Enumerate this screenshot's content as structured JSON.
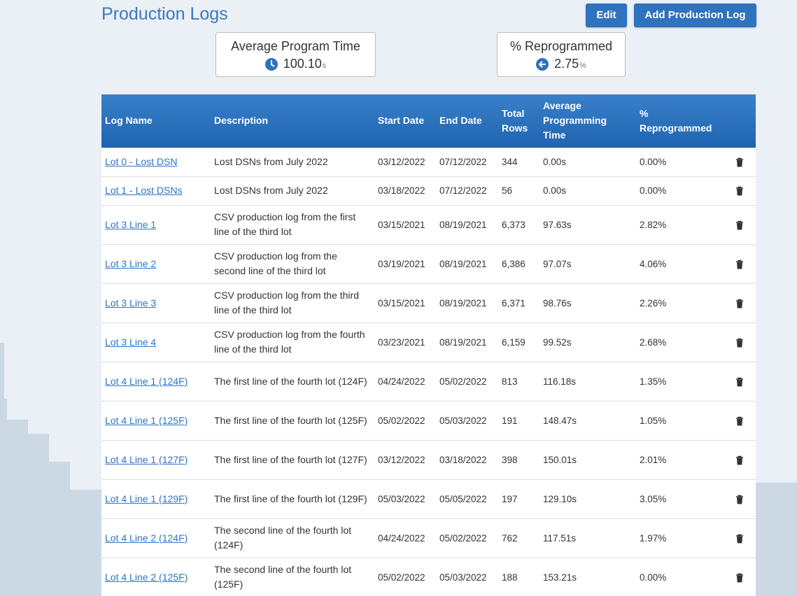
{
  "page": {
    "title": "Production Logs",
    "edit_label": "Edit",
    "add_label": "Add Production Log"
  },
  "stats": {
    "avg": {
      "label": "Average Program Time",
      "value": "100.10",
      "unit": "s",
      "icon": "clock-icon"
    },
    "rep": {
      "label": "% Reprogrammed",
      "value": "2.75",
      "unit": "%",
      "icon": "arrow-left-circle-icon"
    }
  },
  "colors": {
    "accent": "#2f72bd",
    "title": "#3a78c2",
    "link": "#2e74c6",
    "header": "#2a6fbc"
  },
  "table": {
    "headers": {
      "name": "Log Name",
      "desc": "Description",
      "start": "Start Date",
      "end": "End Date",
      "total_1": "Total",
      "total_2": "Rows",
      "avg_1": "Average",
      "avg_2": "Programming",
      "avg_3": "Time",
      "rep_1": "%",
      "rep_2": "Reprogrammed"
    },
    "rows": [
      {
        "name": "Lot 0 - Lost DSN",
        "desc": "Lost DSNs from July 2022",
        "start": "03/12/2022",
        "end": "07/12/2022",
        "total": "344",
        "avg": "0.00s",
        "rep": "0.00%"
      },
      {
        "name": "Lot 1 - Lost DSNs",
        "desc": "Lost DSNs from July 2022",
        "start": "03/18/2022",
        "end": "07/12/2022",
        "total": "56",
        "avg": "0.00s",
        "rep": "0.00%"
      },
      {
        "name": "Lot 3 Line 1",
        "desc": "CSV production log from the first line of the third lot",
        "start": "03/15/2021",
        "end": "08/19/2021",
        "total": "6,373",
        "avg": "97.63s",
        "rep": "2.82%"
      },
      {
        "name": "Lot 3 Line 2",
        "desc": "CSV production log from the second line of the third lot",
        "start": "03/19/2021",
        "end": "08/19/2021",
        "total": "6,386",
        "avg": "97.07s",
        "rep": "4.06%"
      },
      {
        "name": "Lot 3 Line 3",
        "desc": "CSV production log from the third line of the third lot",
        "start": "03/15/2021",
        "end": "08/19/2021",
        "total": "6,371",
        "avg": "98.76s",
        "rep": "2.26%"
      },
      {
        "name": "Lot 3 Line 4",
        "desc": "CSV production log from the fourth line of the third lot",
        "start": "03/23/2021",
        "end": "08/19/2021",
        "total": "6,159",
        "avg": "99.52s",
        "rep": "2.68%"
      },
      {
        "name": "Lot 4 Line 1 (124F)",
        "desc": "The first line of the fourth lot (124F)",
        "start": "04/24/2022",
        "end": "05/02/2022",
        "total": "813",
        "avg": "116.18s",
        "rep": "1.35%"
      },
      {
        "name": "Lot 4 Line 1 (125F)",
        "desc": "The first line of the fourth lot (125F)",
        "start": "05/02/2022",
        "end": "05/03/2022",
        "total": "191",
        "avg": "148.47s",
        "rep": "1.05%"
      },
      {
        "name": "Lot 4 Line 1 (127F)",
        "desc": "The first line of the fourth lot (127F)",
        "start": "03/12/2022",
        "end": "03/18/2022",
        "total": "398",
        "avg": "150.01s",
        "rep": "2.01%"
      },
      {
        "name": "Lot 4 Line 1 (129F)",
        "desc": "The first line of the fourth lot (129F)",
        "start": "05/03/2022",
        "end": "05/05/2022",
        "total": "197",
        "avg": "129.10s",
        "rep": "3.05%"
      },
      {
        "name": "Lot 4 Line 2 (124F)",
        "desc": "The second line of the fourth lot (124F)",
        "start": "04/24/2022",
        "end": "05/02/2022",
        "total": "762",
        "avg": "117.51s",
        "rep": "1.97%"
      },
      {
        "name": "Lot 4 Line 2 (125F)",
        "desc": "The second line of the fourth lot (125F)",
        "start": "05/02/2022",
        "end": "05/03/2022",
        "total": "188",
        "avg": "153.21s",
        "rep": "0.00%"
      }
    ]
  }
}
